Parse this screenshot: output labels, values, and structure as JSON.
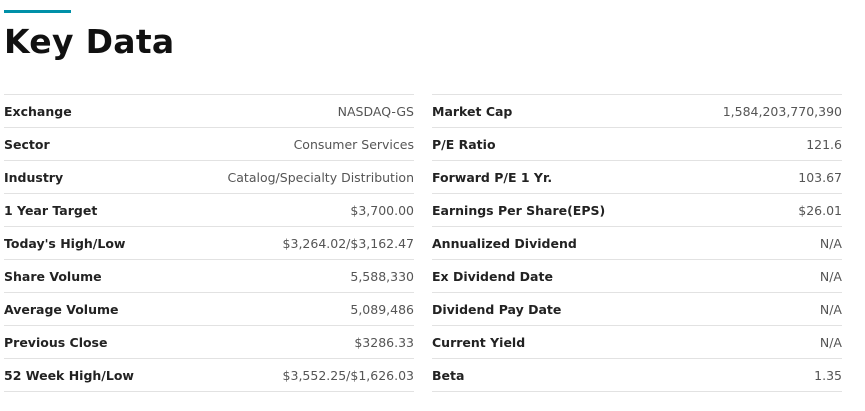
{
  "header": {
    "title": "Key Data",
    "accent_color": "#0090a8"
  },
  "left_table": [
    {
      "label": "Exchange",
      "value": "NASDAQ-GS"
    },
    {
      "label": "Sector",
      "value": "Consumer Services"
    },
    {
      "label": "Industry",
      "value": "Catalog/Specialty Distribution"
    },
    {
      "label": "1 Year Target",
      "value": "$3,700.00"
    },
    {
      "label": "Today's High/Low",
      "value": "$3,264.02/$3,162.47"
    },
    {
      "label": "Share Volume",
      "value": "5,588,330"
    },
    {
      "label": "Average Volume",
      "value": "5,089,486"
    },
    {
      "label": "Previous Close",
      "value": "$3286.33"
    },
    {
      "label": "52 Week High/Low",
      "value": "$3,552.25/$1,626.03"
    }
  ],
  "right_table": [
    {
      "label": "Market Cap",
      "value": "1,584,203,770,390"
    },
    {
      "label": "P/E Ratio",
      "value": "121.6"
    },
    {
      "label": "Forward P/E 1 Yr.",
      "value": "103.67"
    },
    {
      "label": "Earnings Per Share(EPS)",
      "value": "$26.01"
    },
    {
      "label": "Annualized Dividend",
      "value": "N/A"
    },
    {
      "label": "Ex Dividend Date",
      "value": "N/A"
    },
    {
      "label": "Dividend Pay Date",
      "value": "N/A"
    },
    {
      "label": "Current Yield",
      "value": "N/A"
    },
    {
      "label": "Beta",
      "value": "1.35"
    }
  ]
}
